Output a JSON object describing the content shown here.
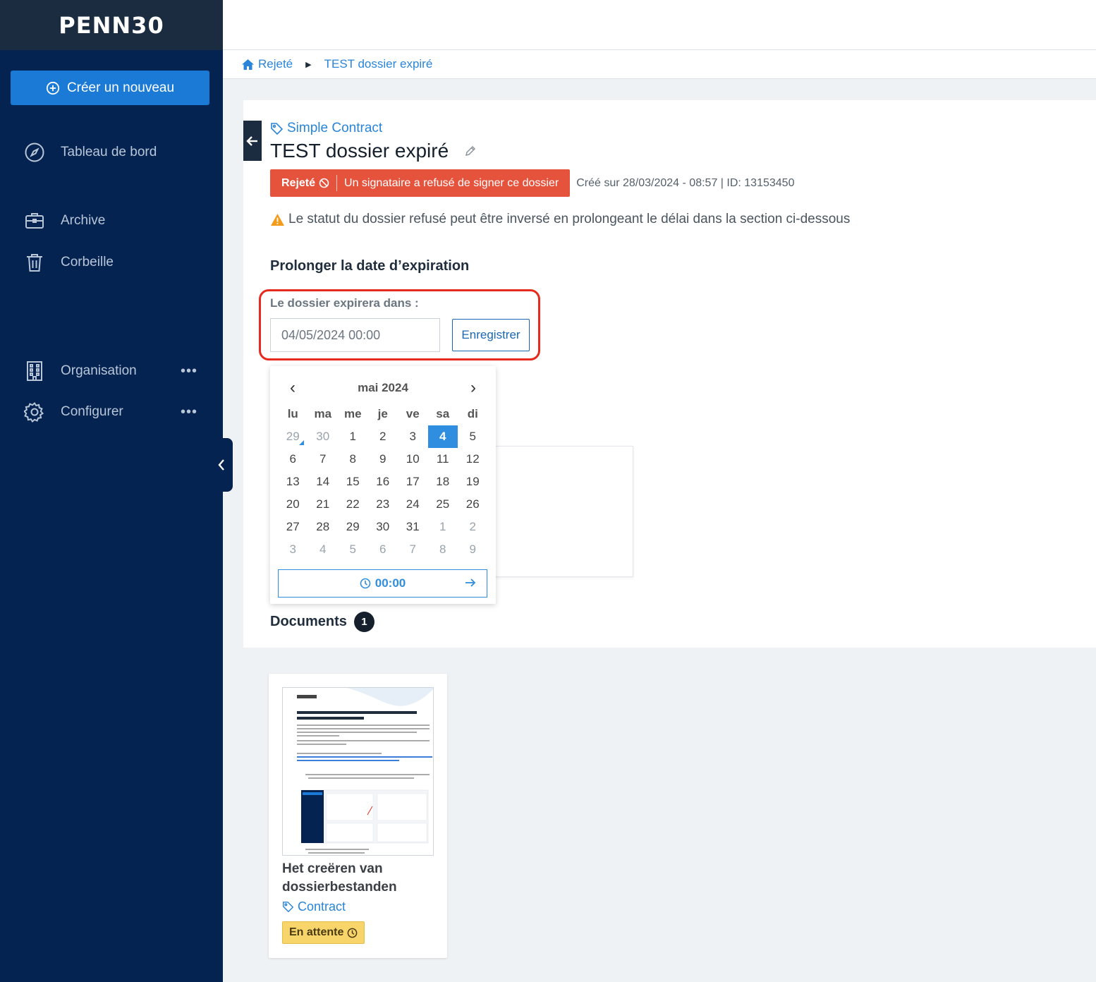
{
  "app": {
    "logo": "PENN30"
  },
  "sidebar": {
    "create_label": "Créer un nouveau",
    "items": [
      {
        "label": "Tableau de bord",
        "icon": "compass-icon"
      },
      {
        "label": "Archive",
        "icon": "briefcase-icon"
      },
      {
        "label": "Corbeille",
        "icon": "trash-icon"
      },
      {
        "label": "Organisation",
        "icon": "building-icon",
        "more": "•••"
      },
      {
        "label": "Configurer",
        "icon": "gear-icon",
        "more": "•••"
      }
    ]
  },
  "breadcrumb": {
    "home": "Rejeté",
    "current": "TEST dossier expiré"
  },
  "case": {
    "type": "Simple Contract",
    "title": "TEST dossier expiré",
    "status": "Rejeté",
    "status_message": "Un signataire a refusé de signer ce dossier",
    "meta": "Créé sur 28/03/2024 - 08:57 | ID: 13153450",
    "warning": "Le statut du dossier refusé peut être inversé en prolongeant le délai dans la section ci-dessous"
  },
  "expiration": {
    "section_title": "Prolonger la date d’expiration",
    "label": "Le dossier expirera dans :",
    "value": "04/05/2024 00:00",
    "save_label": "Enregistrer"
  },
  "calendar": {
    "month": "mai 2024",
    "prev": "‹",
    "next": "›",
    "weekdays": [
      "lu",
      "ma",
      "me",
      "je",
      "ve",
      "sa",
      "di"
    ],
    "days": [
      {
        "d": "29",
        "muted": true,
        "today": true
      },
      {
        "d": "30",
        "muted": true
      },
      {
        "d": "1"
      },
      {
        "d": "2"
      },
      {
        "d": "3"
      },
      {
        "d": "4",
        "selected": true
      },
      {
        "d": "5"
      },
      {
        "d": "6"
      },
      {
        "d": "7"
      },
      {
        "d": "8"
      },
      {
        "d": "9"
      },
      {
        "d": "10"
      },
      {
        "d": "11"
      },
      {
        "d": "12"
      },
      {
        "d": "13"
      },
      {
        "d": "14"
      },
      {
        "d": "15"
      },
      {
        "d": "16"
      },
      {
        "d": "17"
      },
      {
        "d": "18"
      },
      {
        "d": "19"
      },
      {
        "d": "20"
      },
      {
        "d": "21"
      },
      {
        "d": "22"
      },
      {
        "d": "23"
      },
      {
        "d": "24"
      },
      {
        "d": "25"
      },
      {
        "d": "26"
      },
      {
        "d": "27"
      },
      {
        "d": "28"
      },
      {
        "d": "29"
      },
      {
        "d": "30"
      },
      {
        "d": "31"
      },
      {
        "d": "1",
        "muted": true
      },
      {
        "d": "2",
        "muted": true
      },
      {
        "d": "3",
        "muted": true
      },
      {
        "d": "4",
        "muted": true
      },
      {
        "d": "5",
        "muted": true
      },
      {
        "d": "6",
        "muted": true
      },
      {
        "d": "7",
        "muted": true
      },
      {
        "d": "8",
        "muted": true
      },
      {
        "d": "9",
        "muted": true
      }
    ],
    "time": "00:00"
  },
  "documents": {
    "title": "Documents",
    "count": "1",
    "items": [
      {
        "name": "Het creëren van dossierbestanden",
        "type": "Contract",
        "status": "En attente"
      }
    ]
  },
  "colors": {
    "sidebar_bg": "#052351",
    "accent": "#1a7ad5",
    "rejected": "#e5533d",
    "pending": "#f7d56b",
    "highlight": "#e62a1e"
  }
}
